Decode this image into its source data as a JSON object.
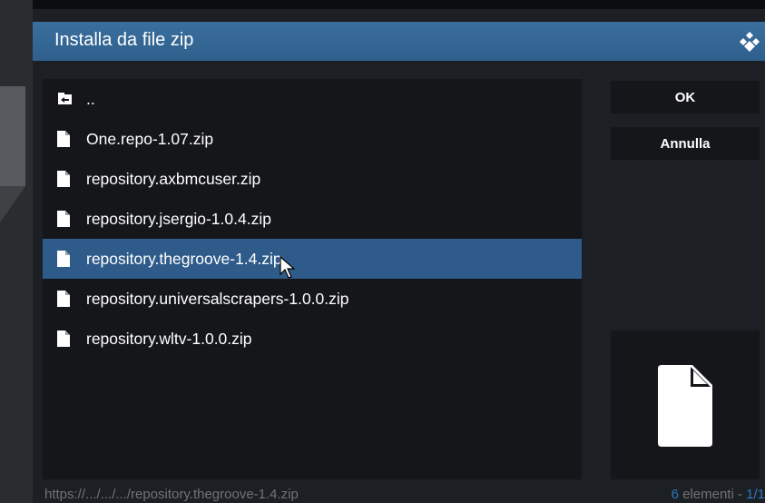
{
  "dialog": {
    "title": "Installa da file zip"
  },
  "files": [
    {
      "label": "..",
      "icon": "folder-back-icon"
    },
    {
      "label": "One.repo-1.07.zip",
      "icon": "file-icon"
    },
    {
      "label": "repository.axbmcuser.zip",
      "icon": "file-icon"
    },
    {
      "label": "repository.jsergio-1.0.4.zip",
      "icon": "file-icon"
    },
    {
      "label": "repository.thegroove-1.4.zip",
      "icon": "file-icon",
      "selected": true
    },
    {
      "label": "repository.universalscrapers-1.0.0.zip",
      "icon": "file-icon"
    },
    {
      "label": "repository.wltv-1.0.0.zip",
      "icon": "file-icon"
    }
  ],
  "buttons": {
    "ok": "OK",
    "cancel": "Annulla"
  },
  "status": {
    "path": "https://.../.../.../repository.thegroove-1.4.zip",
    "count_number": "6",
    "count_text": " elementi - ",
    "page": "1/1"
  },
  "colors": {
    "header": "#336699",
    "selected_row": "#2e5b8a",
    "accent": "#2f78c0"
  }
}
